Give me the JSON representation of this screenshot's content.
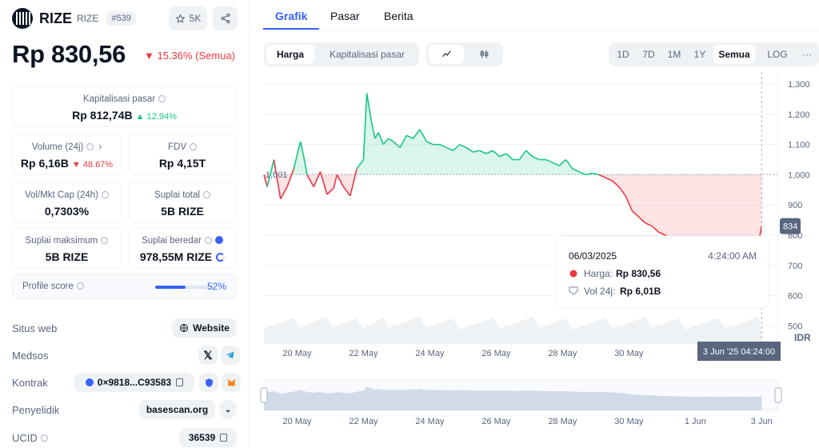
{
  "coin": {
    "name": "RIZE",
    "symbol": "RIZE",
    "rank": "#539",
    "watch_count": "5K",
    "price": "Rp 830,56",
    "change": "▼ 15.36% (Semua)"
  },
  "stats": {
    "market_cap": {
      "label": "Kapitalisasi pasar",
      "value": "Rp 812,74B",
      "change": "▲ 12.94%"
    },
    "volume": {
      "label": "Volume (24j)",
      "value": "Rp 6,16B",
      "change": "▼ 48.67%"
    },
    "fdv": {
      "label": "FDV",
      "value": "Rp 4,15T"
    },
    "vol_mkt": {
      "label": "Vol/Mkt Cap (24h)",
      "value": "0,7303%"
    },
    "total_supply": {
      "label": "Suplai total",
      "value": "5B RIZE"
    },
    "max_supply": {
      "label": "Suplai maksimum",
      "value": "5B RIZE"
    },
    "circ_supply": {
      "label": "Suplai beredar",
      "value": "978,55M RIZE"
    }
  },
  "profile": {
    "label": "Profile score",
    "value": "52%",
    "fraction": 0.52
  },
  "links": {
    "website": {
      "label": "Situs web",
      "button": "Website"
    },
    "social": {
      "label": "Medsos"
    },
    "contract": {
      "label": "Kontrak",
      "value": "0×9818...C93583"
    },
    "explorer": {
      "label": "Penyelidik",
      "value": "basescan.org"
    },
    "ucid": {
      "label": "UCID",
      "value": "36539"
    }
  },
  "tabs": [
    "Grafik",
    "Pasar",
    "Berita"
  ],
  "chart_tabs": [
    "Harga",
    "Kapitalisasi pasar"
  ],
  "ranges": [
    "1D",
    "7D",
    "1M",
    "1Y",
    "Semua",
    "LOG",
    "···"
  ],
  "tooltip": {
    "date": "06/03/2025",
    "time": "4:24:00 AM",
    "price_label": "Harga:",
    "price": "Rp 830,56",
    "vol_label": "Vol 24j:",
    "vol": "Rp 6,01B"
  },
  "colors": {
    "up": "#16c784",
    "down": "#ea3943",
    "accent": "#3861fb"
  },
  "chart_data": {
    "type": "area",
    "baseline": 1001,
    "baseline_label": "1,001",
    "current_label": "834",
    "crosshair_label": "3 Jun '25 04:24:00",
    "ylabel": "IDR",
    "yticks": [
      500,
      600,
      700,
      800,
      900,
      1000,
      1100,
      1200,
      1300
    ],
    "ytick_labels": [
      "500",
      "600",
      "700",
      "800",
      "900",
      "1,000",
      "1,100",
      "1,200",
      "1,300"
    ],
    "ylim": [
      440,
      1340
    ],
    "xlim": [
      0,
      22.8
    ],
    "x_ticks": [
      1,
      3,
      5,
      7,
      9,
      11
    ],
    "x_tick_labels": [
      "20 May",
      "22 May",
      "24 May",
      "26 May",
      "28 May",
      "30 May"
    ],
    "nav_tick_x": [
      1,
      3,
      5,
      7,
      9,
      11,
      13,
      15
    ],
    "nav_tick_labels": [
      "20 May",
      "22 May",
      "24 May",
      "26 May",
      "28 May",
      "30 May",
      "1 Jun",
      "3 Jun"
    ],
    "series": [
      {
        "x": [
          0,
          0.1,
          0.3,
          0.5,
          0.7,
          0.9,
          1.1,
          1.2,
          1.3,
          1.5,
          1.7,
          1.9,
          2.1,
          2.2,
          2.4,
          2.6,
          2.8,
          3.0,
          3.1,
          3.25,
          3.35,
          3.45,
          3.6,
          3.75,
          3.9,
          4.1,
          4.3,
          4.5,
          4.7,
          4.9,
          5.1,
          5.3,
          5.5,
          5.7,
          5.9,
          6.1,
          6.3,
          6.5,
          6.7,
          6.9,
          7.1,
          7.3,
          7.5,
          7.7,
          7.9,
          8.1,
          8.3,
          8.5,
          8.7,
          8.9,
          9.1,
          9.3,
          9.5,
          9.7,
          9.9,
          10.1,
          10.3,
          10.5,
          10.7,
          10.9,
          11.1,
          11.3,
          11.5,
          11.7,
          11.9,
          12.1,
          12.3,
          12.5,
          12.7,
          12.9,
          13.1,
          13.3,
          13.5,
          13.7,
          13.9,
          14.1,
          14.3,
          14.5,
          14.7,
          14.9,
          15.0
        ],
        "y": [
          1000,
          960,
          1050,
          920,
          960,
          1020,
          1110,
          1060,
          1000,
          960,
          1010,
          935,
          955,
          1000,
          960,
          930,
          1020,
          1050,
          1270,
          1170,
          1120,
          1140,
          1100,
          1120,
          1110,
          1090,
          1130,
          1120,
          1150,
          1110,
          1100,
          1100,
          1090,
          1080,
          1100,
          1090,
          1075,
          1080,
          1070,
          1080,
          1060,
          1070,
          1050,
          1050,
          1080,
          1060,
          1050,
          1050,
          1040,
          1030,
          1050,
          1020,
          1010,
          1000,
          1005,
          1000,
          990,
          980,
          960,
          930,
          880,
          860,
          840,
          830,
          810,
          800,
          790,
          780,
          770,
          760,
          760,
          765,
          760,
          755,
          760,
          765,
          770,
          760,
          760,
          770,
          830
        ]
      }
    ]
  }
}
